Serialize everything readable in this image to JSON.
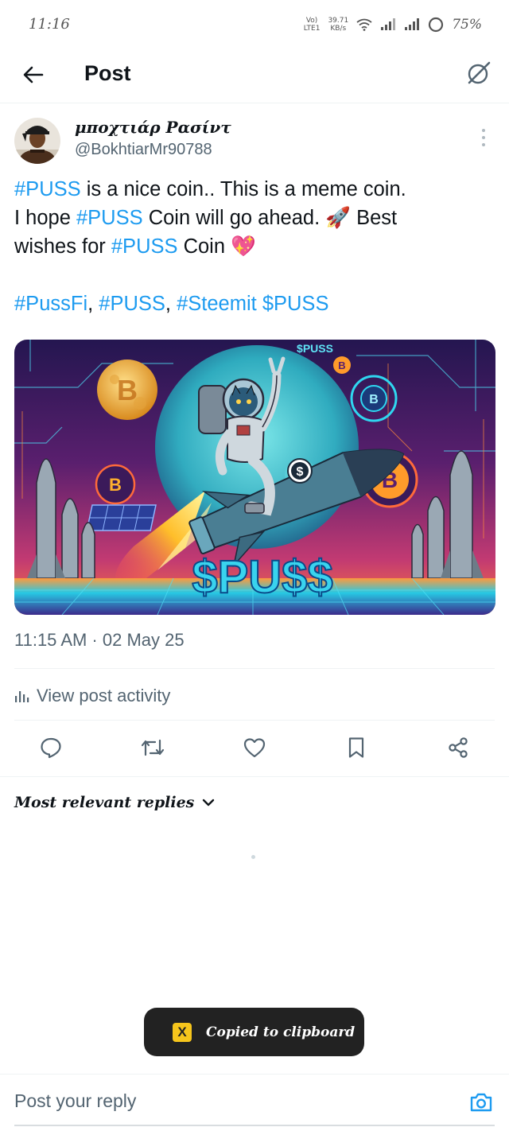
{
  "status_bar": {
    "time": "11:16",
    "net_type_top": "Vo)",
    "net_type_bottom": "LTE1",
    "speed_value": "39.71",
    "speed_unit": "KB/s",
    "battery": "75%"
  },
  "header": {
    "title": "Post",
    "back_icon": "arrow-left-icon",
    "grok_icon": "grok-icon"
  },
  "post": {
    "author_name": "μποχτιάρ Ρασίντ",
    "author_handle": "@BokhtiarMr90788",
    "line1": {
      "tag": "#PUSS",
      "text": " is a nice coin.. This is a meme coin."
    },
    "line2": {
      "pre": "I hope ",
      "tag": "#PUSS",
      "text": " Coin will go ahead. 🚀 Best"
    },
    "line3": {
      "pre": "wishes for ",
      "tag": "#PUSS",
      "text": " Coin 💖"
    },
    "tags_line": {
      "tag1": "#PussFi",
      "sep1": ", ",
      "tag2": "#PUSS",
      "sep2": ", ",
      "tag3": "#Steemit",
      "sep3": " ",
      "tag4": "$PUSS"
    },
    "image": {
      "top_label": "$PUSS",
      "big_label": "$PU$$",
      "coin_symbol": "B",
      "dollar_symbol": "$"
    },
    "timestamp": "11:15 AM · 02 May 25",
    "activity_label": "View post activity"
  },
  "actions": [
    {
      "icon": "reply-icon"
    },
    {
      "icon": "repost-icon"
    },
    {
      "icon": "like-icon"
    },
    {
      "icon": "bookmark-icon"
    },
    {
      "icon": "share-icon"
    }
  ],
  "replies": {
    "filter_label": "Most relevant replies",
    "filter_icon": "chevron-down-icon"
  },
  "toast": {
    "icon_letter": "X",
    "message": "Copied to clipboard"
  },
  "reply_bar": {
    "placeholder": "Post your reply",
    "camera_icon": "camera-icon"
  },
  "colors": {
    "accent": "#1d9bf0",
    "text": "#0f1419",
    "muted": "#536471",
    "toast_bg": "#222222",
    "toast_icon": "#f6c51c"
  }
}
